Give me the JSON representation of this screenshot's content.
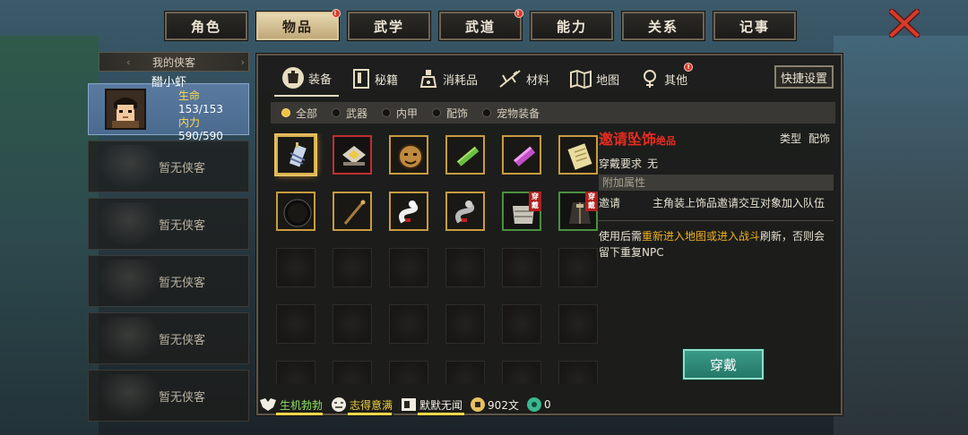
{
  "top_tabs": [
    {
      "label": "角色",
      "active": false,
      "badge": false
    },
    {
      "label": "物品",
      "active": true,
      "badge": true
    },
    {
      "label": "武学",
      "active": false,
      "badge": false
    },
    {
      "label": "武道",
      "active": false,
      "badge": true
    },
    {
      "label": "能力",
      "active": false,
      "badge": false
    },
    {
      "label": "关系",
      "active": false,
      "badge": false
    },
    {
      "label": "记事",
      "active": false,
      "badge": false
    }
  ],
  "badge_mark": "!",
  "heroes": {
    "header": "我的侠客",
    "active": {
      "name": "醋小虾",
      "hp_label": "生命",
      "hp": "153/153",
      "mp_label": "内力",
      "mp": "590/590"
    },
    "empty_label": "暂无侠客"
  },
  "categories": [
    {
      "label": "装备",
      "icon": "armor-icon",
      "active": true
    },
    {
      "label": "秘籍",
      "icon": "book-icon",
      "active": false
    },
    {
      "label": "消耗品",
      "icon": "potion-icon",
      "active": false
    },
    {
      "label": "材料",
      "icon": "material-icon",
      "active": false
    },
    {
      "label": "地图",
      "icon": "map-icon",
      "active": false
    },
    {
      "label": "其他",
      "icon": "other-icon",
      "active": false,
      "badge": true
    }
  ],
  "quick_settings": "快捷设置",
  "filters": [
    {
      "label": "全部",
      "selected": true
    },
    {
      "label": "武器",
      "selected": false
    },
    {
      "label": "内甲",
      "selected": false
    },
    {
      "label": "配饰",
      "selected": false
    },
    {
      "label": "宠物装备",
      "selected": false
    }
  ],
  "items": [
    {
      "icon": "scroll-charm-icon",
      "border": "gold",
      "selected": true
    },
    {
      "icon": "gem-box-icon",
      "border": "red"
    },
    {
      "icon": "monk-mask-icon",
      "border": "gold"
    },
    {
      "icon": "green-bar-icon",
      "border": "gold"
    },
    {
      "icon": "purple-crystal-icon",
      "border": "gold"
    },
    {
      "icon": "paper-scroll-icon",
      "border": "gold"
    },
    {
      "icon": "black-ring-icon",
      "border": "gold"
    },
    {
      "icon": "wooden-staff-icon",
      "border": "gold"
    },
    {
      "icon": "white-snake-icon",
      "border": "gold"
    },
    {
      "icon": "grey-snake-icon",
      "border": "gold"
    },
    {
      "icon": "bandage-armor-icon",
      "border": "green",
      "tag": "穿戴"
    },
    {
      "icon": "dark-robe-icon",
      "border": "green",
      "tag": "穿戴"
    }
  ],
  "detail": {
    "name": "邀请坠饰",
    "grade": "绝品",
    "type_label": "类型",
    "type_value": "配饰",
    "req_label": "穿戴要求",
    "req_value": "无",
    "section_title": "附加属性",
    "attr_key": "邀请",
    "attr_value": "主角装上饰品邀请交互对象加入队伍",
    "note_1": "使用后需",
    "note_highlight": "重新进入地图或进入战斗",
    "note_2": "刷新，否则会留下重复NPC",
    "equip_button": "穿戴"
  },
  "status": [
    {
      "label": "生机勃勃",
      "icon": "vitality-icon",
      "level": 1.0
    },
    {
      "label": "志得意满",
      "icon": "mood-icon",
      "level": 0.95
    },
    {
      "label": "默默无闻",
      "icon": "fame-icon",
      "level": 1.0
    }
  ],
  "money": "902文",
  "jade": "0",
  "colors": {
    "accent": "#e8c060",
    "item_name": "#e82c20",
    "highlight": "#f0b020",
    "equip_btn": "#2e8a78"
  }
}
